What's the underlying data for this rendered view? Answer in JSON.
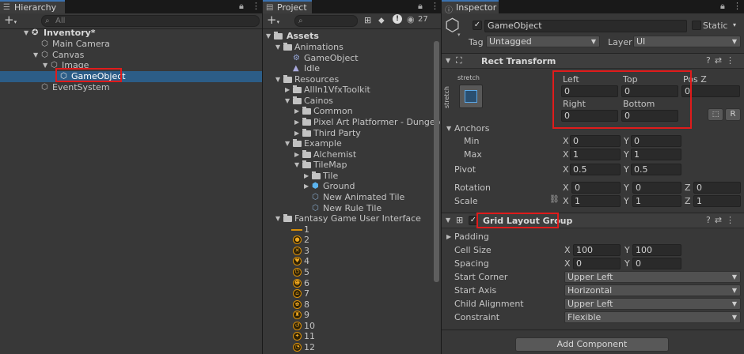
{
  "hierarchy": {
    "tab": "Hierarchy",
    "search_placeholder": "All",
    "scene": "Inventory*",
    "items": [
      {
        "label": "Main Camera"
      },
      {
        "label": "Canvas"
      },
      {
        "label": "Image"
      },
      {
        "label": "GameObject"
      },
      {
        "label": "EventSystem"
      }
    ]
  },
  "project": {
    "tab": "Project",
    "hidden_count": "27",
    "assets_label": "Assets",
    "rows": [
      {
        "label": "Animations",
        "type": "folder-open",
        "depth": 1
      },
      {
        "label": "GameObject",
        "type": "controller",
        "depth": 2
      },
      {
        "label": "Idle",
        "type": "anim",
        "depth": 2
      },
      {
        "label": "Resources",
        "type": "folder-open",
        "depth": 1
      },
      {
        "label": "AllIn1VfxToolkit",
        "type": "folder",
        "depth": 2
      },
      {
        "label": "Cainos",
        "type": "folder-open",
        "depth": 2
      },
      {
        "label": "Common",
        "type": "folder",
        "depth": 3
      },
      {
        "label": "Pixel Art Platformer - Dungeon",
        "type": "folder",
        "depth": 3
      },
      {
        "label": "Third Party",
        "type": "folder",
        "depth": 3
      },
      {
        "label": "Example",
        "type": "folder-open",
        "depth": 2
      },
      {
        "label": "Alchemist",
        "type": "folder",
        "depth": 3
      },
      {
        "label": "TileMap",
        "type": "folder-open",
        "depth": 3
      },
      {
        "label": "Tile",
        "type": "folder",
        "depth": 4
      },
      {
        "label": "Ground",
        "type": "prefab",
        "depth": 4
      },
      {
        "label": "New Animated Tile",
        "type": "tile",
        "depth": 4
      },
      {
        "label": "New Rule Tile",
        "type": "tile",
        "depth": 4
      },
      {
        "label": "Fantasy Game User Interface",
        "type": "folder-open",
        "depth": 1
      },
      {
        "label": "1",
        "type": "line",
        "depth": 2
      },
      {
        "label": "2",
        "type": "orb",
        "glyph": "●",
        "depth": 2
      },
      {
        "label": "3",
        "type": "orb",
        "glyph": "✕",
        "depth": 2
      },
      {
        "label": "4",
        "type": "orb",
        "glyph": "♥",
        "depth": 2
      },
      {
        "label": "5",
        "type": "orb",
        "glyph": "⏻",
        "depth": 2
      },
      {
        "label": "6",
        "type": "orb",
        "glyph": "☻",
        "depth": 2
      },
      {
        "label": "7",
        "type": "orb",
        "glyph": "⌂",
        "depth": 2
      },
      {
        "label": "8",
        "type": "orb",
        "glyph": "♚",
        "depth": 2
      },
      {
        "label": "9",
        "type": "orb",
        "glyph": "♜",
        "depth": 2
      },
      {
        "label": "10",
        "type": "orb",
        "glyph": "↺",
        "depth": 2
      },
      {
        "label": "11",
        "type": "orb",
        "glyph": "✦",
        "depth": 2
      },
      {
        "label": "12",
        "type": "orb",
        "glyph": "◔",
        "depth": 2
      }
    ]
  },
  "inspector": {
    "tab": "Inspector",
    "object_name": "GameObject",
    "static_label": "Static",
    "tag_label": "Tag",
    "tag_value": "Untagged",
    "layer_label": "Layer",
    "layer_value": "UI",
    "rect_transform": {
      "title": "Rect Transform",
      "preset_label": "stretch",
      "preset_side_label": "stretch",
      "left_label": "Left",
      "left": "0",
      "top_label": "Top",
      "top": "0",
      "posz_label": "Pos Z",
      "posz": "0",
      "right_label": "Right",
      "right": "0",
      "bottom_label": "Bottom",
      "bottom": "0",
      "r_button": "R",
      "anchors_label": "Anchors",
      "min_label": "Min",
      "min_x": "0",
      "min_y": "0",
      "max_label": "Max",
      "max_x": "1",
      "max_y": "1",
      "pivot_label": "Pivot",
      "pivot_x": "0.5",
      "pivot_y": "0.5",
      "rotation_label": "Rotation",
      "rot_x": "0",
      "rot_y": "0",
      "rot_z": "0",
      "scale_label": "Scale",
      "scale_x": "1",
      "scale_y": "1",
      "scale_z": "1",
      "axis_x": "X",
      "axis_y": "Y",
      "axis_z": "Z"
    },
    "grid_layout": {
      "title": "Grid Layout Group",
      "padding_label": "Padding",
      "cell_size_label": "Cell Size",
      "cell_x": "100",
      "cell_y": "100",
      "spacing_label": "Spacing",
      "spacing_x": "0",
      "spacing_y": "0",
      "start_corner_label": "Start Corner",
      "start_corner": "Upper Left",
      "start_axis_label": "Start Axis",
      "start_axis": "Horizontal",
      "child_alignment_label": "Child Alignment",
      "child_alignment": "Upper Left",
      "constraint_label": "Constraint",
      "constraint": "Flexible"
    },
    "add_component": "Add Component"
  }
}
